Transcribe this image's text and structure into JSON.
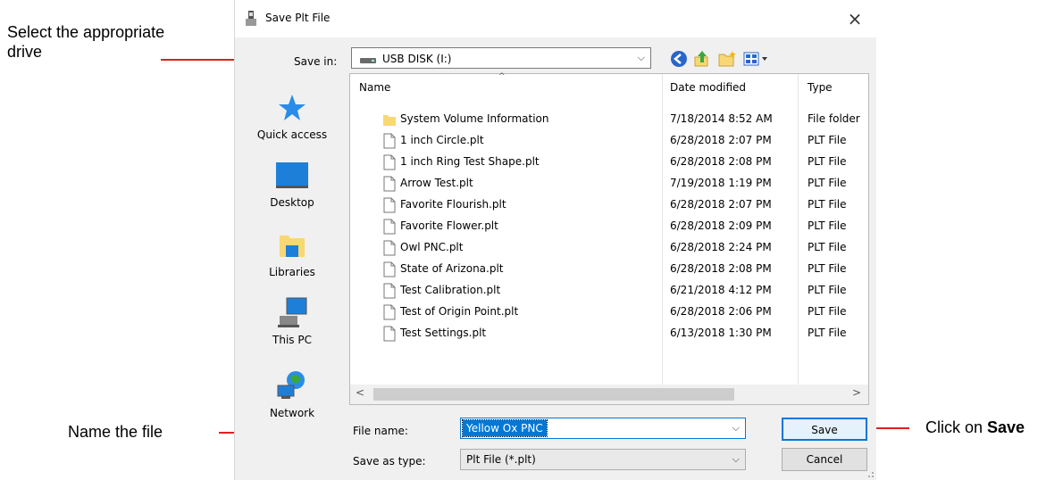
{
  "annotations": {
    "select_drive_line1": "Select the appropriate",
    "select_drive_line2": "drive",
    "name_file": "Name the file",
    "click_prefix": "Click on ",
    "click_bold": "Save"
  },
  "dialog": {
    "title": "Save Plt File",
    "close": "×",
    "save_in_label": "Save in:",
    "save_in_value": "USB DISK (I:)",
    "sidebar": [
      {
        "label": "Quick access",
        "icon": "star-icon"
      },
      {
        "label": "Desktop",
        "icon": "desktop-icon"
      },
      {
        "label": "Libraries",
        "icon": "libraries-icon"
      },
      {
        "label": "This PC",
        "icon": "pc-icon"
      },
      {
        "label": "Network",
        "icon": "network-icon"
      }
    ],
    "columns": {
      "name": "Name",
      "date": "Date modified",
      "type": "Type"
    },
    "files": [
      {
        "name": "System Volume Information",
        "date": "7/18/2014 8:52 AM",
        "type": "File folder",
        "kind": "folder"
      },
      {
        "name": "1 inch Circle.plt",
        "date": "6/28/2018 2:07 PM",
        "type": "PLT File",
        "kind": "file"
      },
      {
        "name": "1 inch Ring Test Shape.plt",
        "date": "6/28/2018 2:08 PM",
        "type": "PLT File",
        "kind": "file"
      },
      {
        "name": "Arrow Test.plt",
        "date": "7/19/2018 1:19 PM",
        "type": "PLT File",
        "kind": "file"
      },
      {
        "name": "Favorite Flourish.plt",
        "date": "6/28/2018 2:07 PM",
        "type": "PLT File",
        "kind": "file"
      },
      {
        "name": "Favorite Flower.plt",
        "date": "6/28/2018 2:09 PM",
        "type": "PLT File",
        "kind": "file"
      },
      {
        "name": "Owl PNC.plt",
        "date": "6/28/2018 2:24 PM",
        "type": "PLT File",
        "kind": "file"
      },
      {
        "name": "State of Arizona.plt",
        "date": "6/28/2018 2:08 PM",
        "type": "PLT File",
        "kind": "file"
      },
      {
        "name": "Test Calibration.plt",
        "date": "6/21/2018 4:12 PM",
        "type": "PLT File",
        "kind": "file"
      },
      {
        "name": "Test of Origin Point.plt",
        "date": "6/28/2018 2:06 PM",
        "type": "PLT File",
        "kind": "file"
      },
      {
        "name": "Test Settings.plt",
        "date": "6/13/2018 1:30 PM",
        "type": "PLT File",
        "kind": "file"
      }
    ],
    "file_name_label": "File name:",
    "file_name_value": "Yellow Ox PNC",
    "save_type_label": "Save as type:",
    "save_type_value": "Plt File (*.plt)",
    "save_button": "Save",
    "cancel_button": "Cancel"
  },
  "colors": {
    "accent": "#0078d7",
    "arrow": "#e02020",
    "folder": "#f8d775"
  }
}
